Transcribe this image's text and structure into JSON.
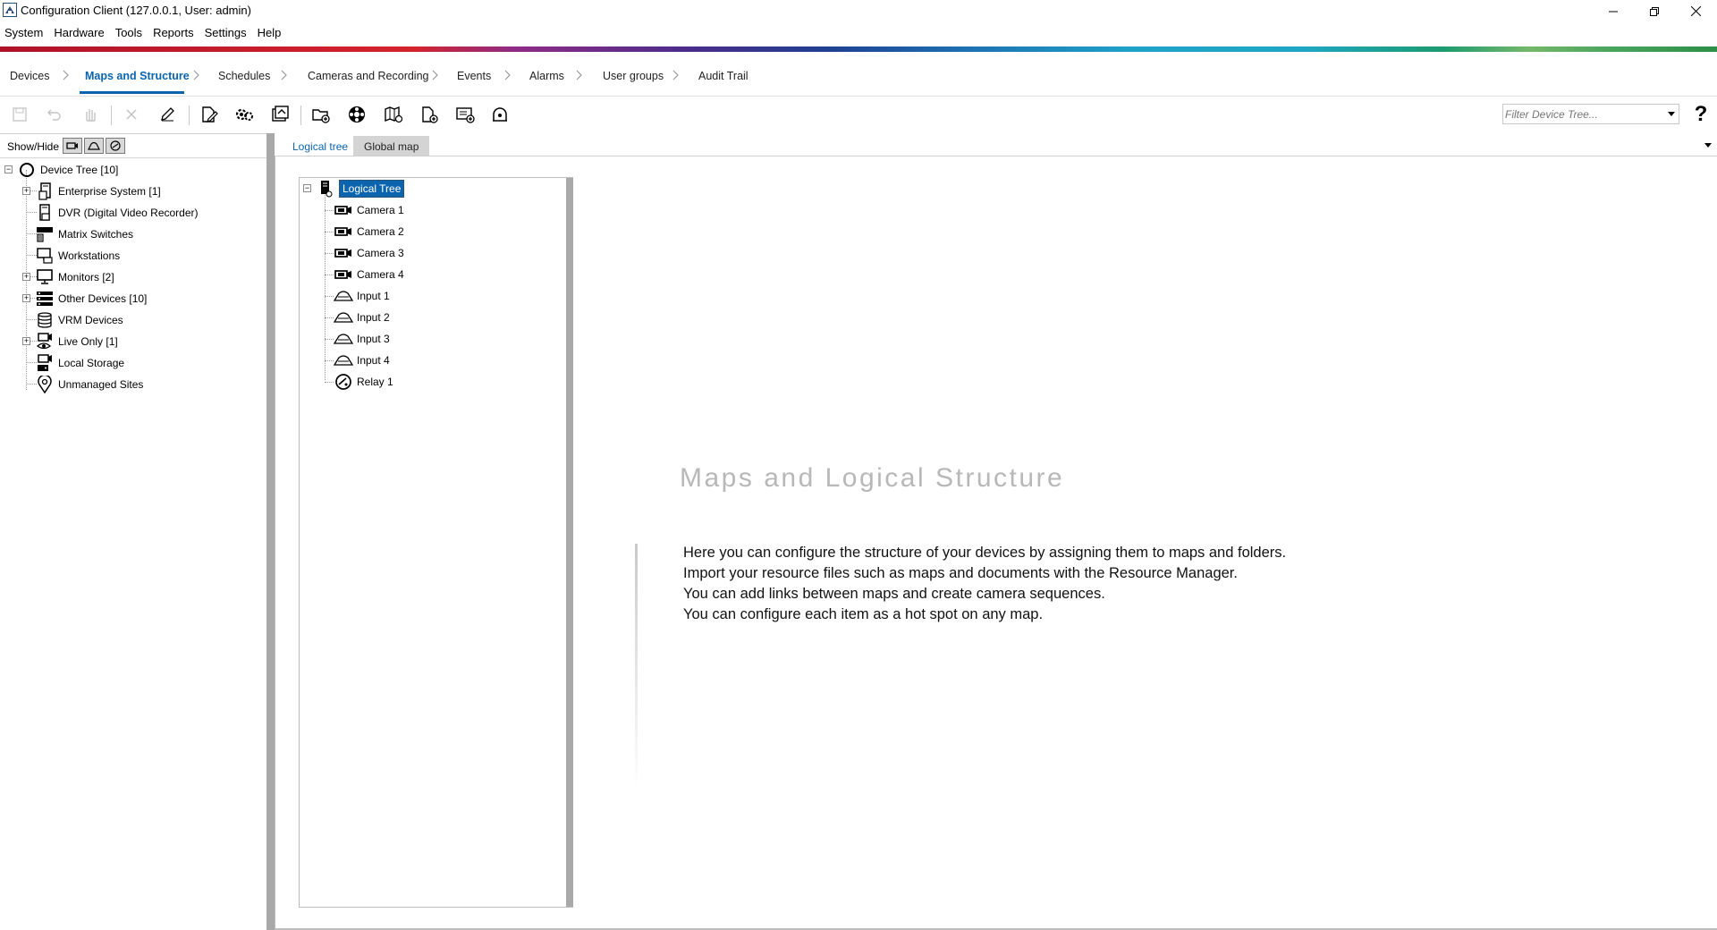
{
  "window": {
    "title": "Configuration Client (127.0.0.1, User: admin)",
    "minimize_icon": "minimize-icon",
    "restore_icon": "restore-icon",
    "close_icon": "close-icon"
  },
  "menu": [
    "System",
    "Hardware",
    "Tools",
    "Reports",
    "Settings",
    "Help"
  ],
  "nav_tabs": [
    {
      "label": "Devices",
      "active": false
    },
    {
      "label": "Maps and Structure",
      "active": true
    },
    {
      "label": "Schedules",
      "active": false
    },
    {
      "label": "Cameras and Recording",
      "active": false
    },
    {
      "label": "Events",
      "active": false
    },
    {
      "label": "Alarms",
      "active": false
    },
    {
      "label": "User groups",
      "active": false
    },
    {
      "label": "Audit Trail",
      "active": false
    }
  ],
  "toolbar": {
    "icons": [
      "save-icon",
      "undo-icon",
      "hand-icon",
      "delete-icon",
      "rename-icon",
      "edit-map-icon",
      "add-folder-icon",
      "resource-manager-icon",
      "new-folder-icon",
      "sequence-icon",
      "add-map-icon",
      "add-document-icon",
      "add-relay-icon",
      "alarm-icon"
    ],
    "filter_placeholder": "Filter Device Tree...",
    "help_label": "?"
  },
  "show_hide": {
    "label": "Show/Hide",
    "buttons": [
      "camera-filter-icon",
      "input-filter-icon",
      "relay-filter-icon"
    ]
  },
  "device_tree": [
    {
      "label": "Device Tree [10]",
      "icon": "device-tree-root-icon",
      "level": 0,
      "expandable": true
    },
    {
      "label": "Enterprise System [1]",
      "icon": "enterprise-system-icon",
      "level": 1,
      "expandable": true
    },
    {
      "label": "DVR (Digital Video Recorder)",
      "icon": "dvr-icon",
      "level": 1,
      "expandable": false
    },
    {
      "label": "Matrix Switches",
      "icon": "matrix-switch-icon",
      "level": 1,
      "expandable": false
    },
    {
      "label": "Workstations",
      "icon": "workstation-icon",
      "level": 1,
      "expandable": false
    },
    {
      "label": "Monitors [2]",
      "icon": "monitor-icon",
      "level": 1,
      "expandable": true
    },
    {
      "label": "Other Devices [10]",
      "icon": "other-devices-icon",
      "level": 1,
      "expandable": true
    },
    {
      "label": "VRM Devices",
      "icon": "vrm-devices-icon",
      "level": 1,
      "expandable": false
    },
    {
      "label": "Live Only [1]",
      "icon": "live-only-icon",
      "level": 1,
      "expandable": true
    },
    {
      "label": "Local Storage",
      "icon": "local-storage-icon",
      "level": 1,
      "expandable": false
    },
    {
      "label": "Unmanaged Sites",
      "icon": "unmanaged-sites-icon",
      "level": 1,
      "expandable": false
    }
  ],
  "subtabs": {
    "logical": "Logical tree",
    "global": "Global map"
  },
  "logical_tree": {
    "root": "Logical Tree",
    "items": [
      {
        "label": "Camera 1",
        "icon": "camera-icon"
      },
      {
        "label": "Camera 2",
        "icon": "camera-icon"
      },
      {
        "label": "Camera 3",
        "icon": "camera-icon"
      },
      {
        "label": "Camera 4",
        "icon": "camera-icon"
      },
      {
        "label": "Input 1",
        "icon": "input-icon"
      },
      {
        "label": "Input 2",
        "icon": "input-icon"
      },
      {
        "label": "Input 3",
        "icon": "input-icon"
      },
      {
        "label": "Input 4",
        "icon": "input-icon"
      },
      {
        "label": "Relay 1",
        "icon": "relay-icon"
      }
    ]
  },
  "welcome": {
    "title": "Maps and Logical Structure",
    "lines": [
      "Here you can configure the structure of your devices by assigning them to maps and folders.",
      "Import your resource files such as maps and documents with the Resource Manager.",
      "You can add links between maps and create camera sequences.",
      "You can configure each item as a hot spot on any map."
    ]
  },
  "colors": {
    "accent": "#0a64ae",
    "splitter": "#a9a9a9",
    "welcome_title": "#b8b8b8"
  }
}
